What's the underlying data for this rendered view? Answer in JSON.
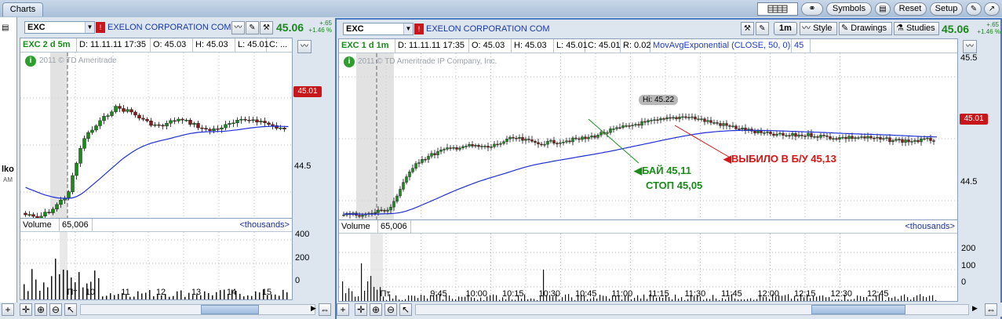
{
  "app": {
    "tab_label": "Charts"
  },
  "toolbar": {
    "symbols_label": "Symbols",
    "reset_label": "Reset",
    "setup_label": "Setup"
  },
  "left": {
    "symbol": "EXC",
    "company": "EXELON CORPORATION COM",
    "price": "45.06",
    "change": "+.65",
    "change_pct": "+1.46 %",
    "info": {
      "title": "EXC 2 d 5m",
      "date": "D: 11.11.11 17:35",
      "open": "O: 45.03",
      "high": "H: 45.03",
      "low": "L: 45.01",
      "close": "C: ..."
    },
    "watermark": "2011 © TD Ameritrade",
    "y_labels": [
      "44.5"
    ],
    "price_tag": "45.01",
    "volume": {
      "label": "Volume",
      "value": "65,006",
      "units": "<thousands>",
      "y_labels": [
        "400",
        "200",
        "0"
      ]
    },
    "x_labels": [
      "Пт",
      "10",
      "11",
      "12",
      "13",
      "14",
      "15"
    ],
    "side_text": [
      "lko",
      "AM"
    ]
  },
  "right": {
    "symbol": "EXC",
    "company": "EXELON CORPORATION COM",
    "timeframe": "1m",
    "style_label": "Style",
    "drawings_label": "Drawings",
    "studies_label": "Studies",
    "price": "45.06",
    "change": "+.65",
    "change_pct": "+1.46 %",
    "info": {
      "title": "EXC 1 d 1m",
      "date": "D: 11.11.11 17:35",
      "open": "O: 45.03",
      "high": "H: 45.03",
      "low": "L: 45.01",
      "close": "C: 45.01",
      "range": "R: 0.02",
      "study": "MovAvgExponential (CLOSE, 50, 0)",
      "study_value": "45"
    },
    "watermark": "2011 © TD Ameritrade IP Company, Inc.",
    "hi_label": "Hi: 45.22",
    "y_labels": [
      "45.5",
      "45",
      "44.5"
    ],
    "price_tag": "45.01",
    "annotations": {
      "buy": "БАЙ 45,11",
      "stop": "СТОП 45,05",
      "stopped": "ВЫБИЛО В Б/У 45,13"
    },
    "volume": {
      "label": "Volume",
      "value": "65,006",
      "units": "<thousands>",
      "y_labels": [
        "200",
        "100",
        "0"
      ]
    },
    "x_labels": [
      "Пт",
      "9:45",
      "10:00",
      "10:15",
      "10:30",
      "10:45",
      "11:00",
      "11:15",
      "11:30",
      "11:45",
      "12:00",
      "12:15",
      "12:30",
      "12:45"
    ]
  },
  "colors": {
    "up": "#1a8a1a",
    "down": "#8b1a1a",
    "ema": "#1f2fd6",
    "buy": "#1a8c1a",
    "stop": "#d41616",
    "grid": "#bbbbbb"
  }
}
